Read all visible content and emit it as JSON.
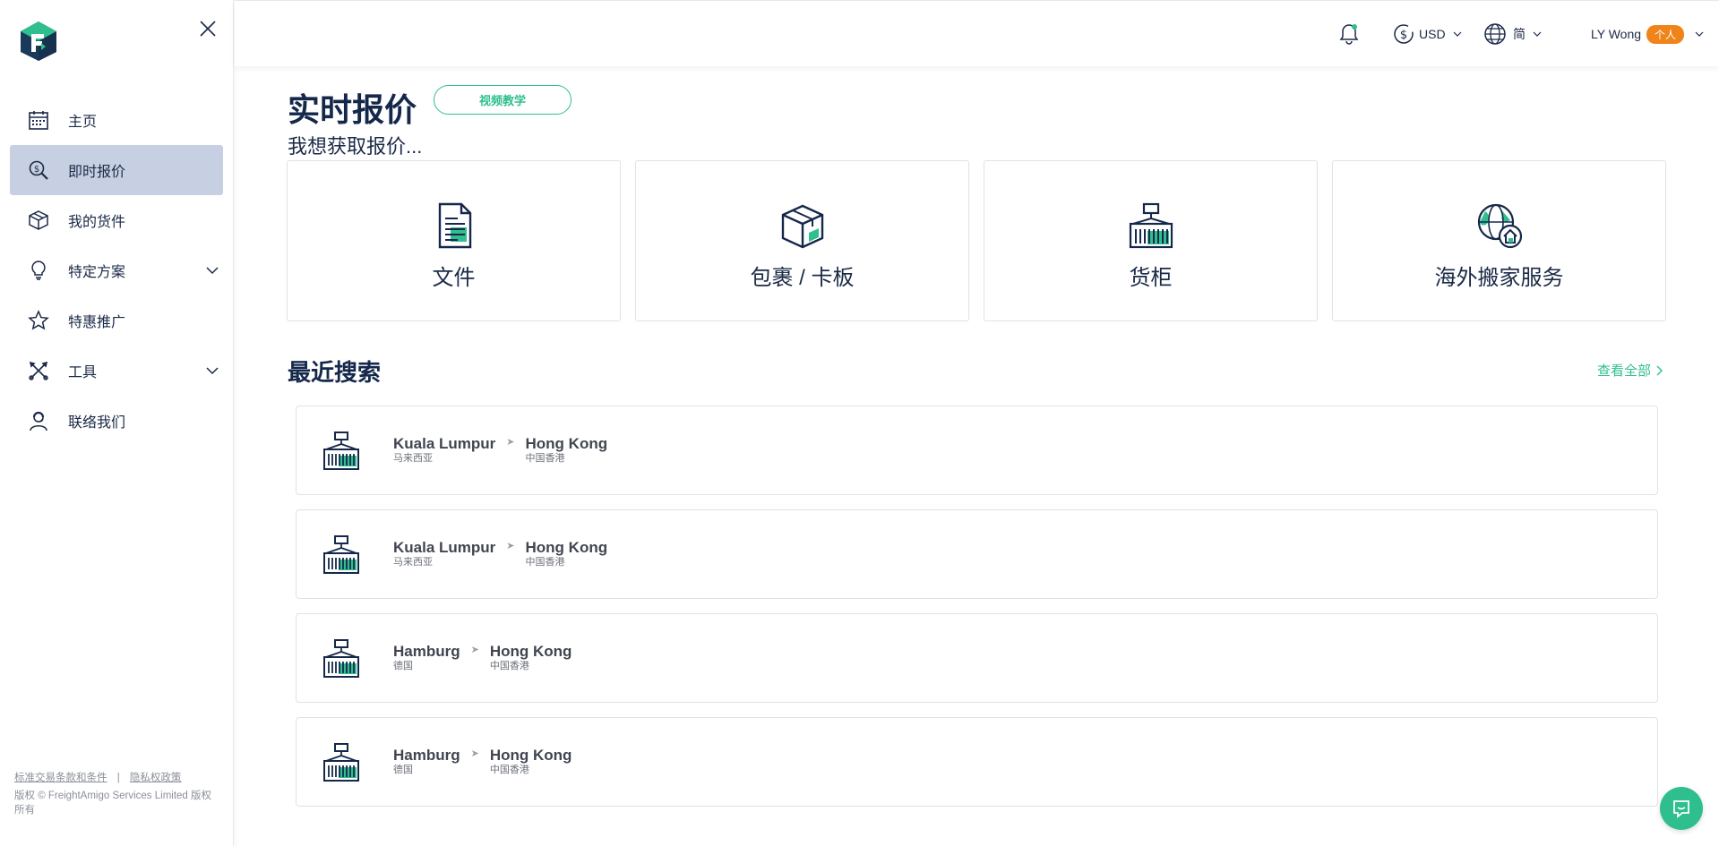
{
  "sidebar": {
    "items": [
      {
        "label": "主页",
        "icon": "calendar-icon"
      },
      {
        "label": "即时报价",
        "icon": "quote-search-icon"
      },
      {
        "label": "我的货件",
        "icon": "box-icon"
      },
      {
        "label": "特定方案",
        "icon": "lightbulb-icon"
      },
      {
        "label": "特惠推广",
        "icon": "star-icon"
      },
      {
        "label": "工具",
        "icon": "tools-icon"
      },
      {
        "label": "联络我们",
        "icon": "support-agent-icon"
      }
    ],
    "active_index": 1,
    "footer": {
      "terms": "标准交易条款和条件",
      "separator": "|",
      "privacy": "隐私权政策",
      "copyright": "版权 © FreightAmigo Services Limited 版权所有"
    }
  },
  "topbar": {
    "currency": "USD",
    "language": "简",
    "user": "LY Wong",
    "user_badge": "个人"
  },
  "main": {
    "title": "实时报价",
    "video_button": "视频教学",
    "subtitle": "我想获取报价...",
    "cards": [
      {
        "label": "文件",
        "icon": "document-icon"
      },
      {
        "label": "包裹 / 卡板",
        "icon": "parcel-icon"
      },
      {
        "label": "货柜",
        "icon": "container-icon"
      },
      {
        "label": "海外搬家服务",
        "icon": "globe-home-icon"
      }
    ],
    "recent_title": "最近搜索",
    "view_all": "查看全部",
    "recent": [
      {
        "from_city": "Kuala Lumpur",
        "from_country": "马来西亚",
        "to_city": "Hong Kong",
        "to_country": "中国香港"
      },
      {
        "from_city": "Kuala Lumpur",
        "from_country": "马来西亚",
        "to_city": "Hong Kong",
        "to_country": "中国香港"
      },
      {
        "from_city": "Hamburg",
        "from_country": "德国",
        "to_city": "Hong Kong",
        "to_country": "中国香港"
      },
      {
        "from_city": "Hamburg",
        "from_country": "德国",
        "to_city": "Hong Kong",
        "to_country": "中国香港"
      }
    ]
  },
  "colors": {
    "brand_navy": "#15284b",
    "accent_green": "#2fbf8e",
    "active_nav": "#c7d0e2",
    "badge_orange": "#f0841b"
  }
}
